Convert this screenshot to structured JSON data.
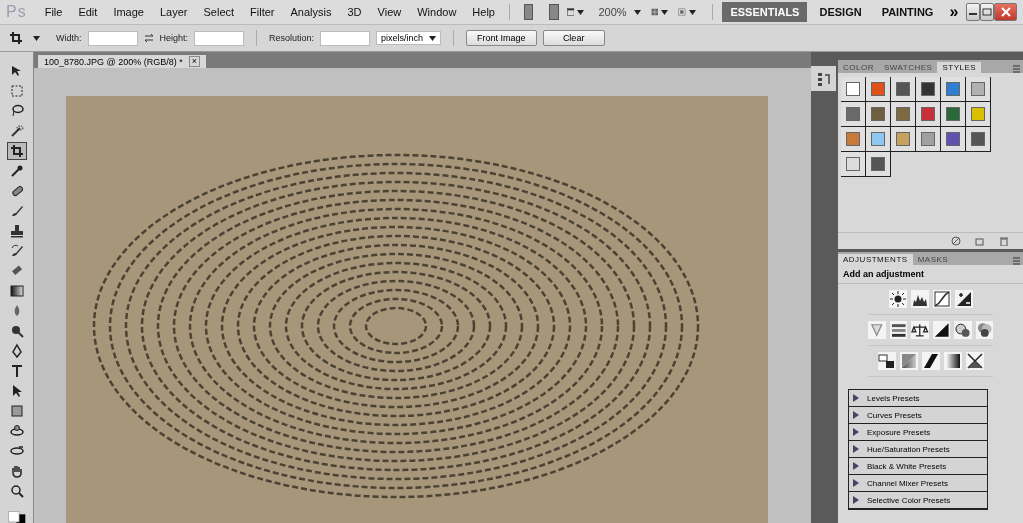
{
  "app_logo": "Ps",
  "menu": [
    "File",
    "Edit",
    "Image",
    "Layer",
    "Select",
    "Filter",
    "Analysis",
    "3D",
    "View",
    "Window",
    "Help"
  ],
  "zoom": "200%",
  "workspaces": [
    {
      "label": "ESSENTIALS",
      "selected": true
    },
    {
      "label": "DESIGN",
      "selected": false
    },
    {
      "label": "PAINTING",
      "selected": false
    }
  ],
  "more": "»",
  "options": {
    "width_label": "Width:",
    "height_label": "Height:",
    "resolution_label": "Resolution:",
    "unit": "pixels/inch",
    "buttons": [
      "Front Image",
      "Clear"
    ]
  },
  "document_tab": {
    "title": "100_8780.JPG @ 200% (RGB/8) *",
    "close": "×"
  },
  "tools": [
    {
      "kind": "move",
      "selected": false
    },
    {
      "kind": "marquee",
      "selected": false
    },
    {
      "kind": "lasso",
      "selected": false
    },
    {
      "kind": "quick-select",
      "selected": false
    },
    {
      "kind": "crop",
      "selected": true
    },
    {
      "kind": "eyedropper",
      "selected": false
    },
    {
      "kind": "healing",
      "selected": false
    },
    {
      "kind": "brush",
      "selected": false
    },
    {
      "kind": "stamp",
      "selected": false
    },
    {
      "kind": "history-brush",
      "selected": false
    },
    {
      "kind": "eraser",
      "selected": false
    },
    {
      "kind": "gradient",
      "selected": false
    },
    {
      "kind": "blur",
      "selected": false
    },
    {
      "kind": "dodge",
      "selected": false
    },
    {
      "kind": "pen",
      "selected": false
    },
    {
      "kind": "type",
      "selected": false
    },
    {
      "kind": "path-select",
      "selected": false
    },
    {
      "kind": "shape",
      "selected": false
    },
    {
      "kind": "rotate-3d",
      "selected": false
    },
    {
      "kind": "orbit-3d",
      "selected": false
    },
    {
      "kind": "hand",
      "selected": false
    },
    {
      "kind": "zoom",
      "selected": false
    }
  ],
  "style_panel": {
    "tabs": [
      {
        "label": "COLOR",
        "selected": false
      },
      {
        "label": "SWATCHES",
        "selected": false
      },
      {
        "label": "STYLES",
        "selected": true
      }
    ],
    "swatches": [
      {
        "color": "#ffffff"
      },
      {
        "color": "#e0501a"
      },
      {
        "color": "#555555"
      },
      {
        "color": "#333333"
      },
      {
        "color": "#2f7fd0"
      },
      {
        "color": "#b0b0b0"
      },
      {
        "color": "#6a6a6a"
      },
      {
        "color": "#6e5f3e"
      },
      {
        "color": "#7e6a42"
      },
      {
        "color": "#c8303a"
      },
      {
        "color": "#2a6a3a"
      },
      {
        "color": "#d8c000"
      },
      {
        "color": "#c87a3a"
      },
      {
        "color": "#8ec8f0"
      },
      {
        "color": "#c8a060"
      },
      {
        "color": "#a0a0a0"
      },
      {
        "color": "#6050b0"
      },
      {
        "color": "#555555"
      },
      {
        "color": "#dcdcdc"
      },
      {
        "color": "#555555"
      }
    ]
  },
  "adjustments_panel": {
    "tabs": [
      {
        "label": "ADJUSTMENTS",
        "selected": true
      },
      {
        "label": "MASKS",
        "selected": false
      }
    ],
    "heading": "Add an adjustment",
    "presets": [
      "Levels Presets",
      "Curves Presets",
      "Exposure Presets",
      "Hue/Saturation Presets",
      "Black & White Presets",
      "Channel Mixer Presets",
      "Selective Color Presets"
    ]
  }
}
